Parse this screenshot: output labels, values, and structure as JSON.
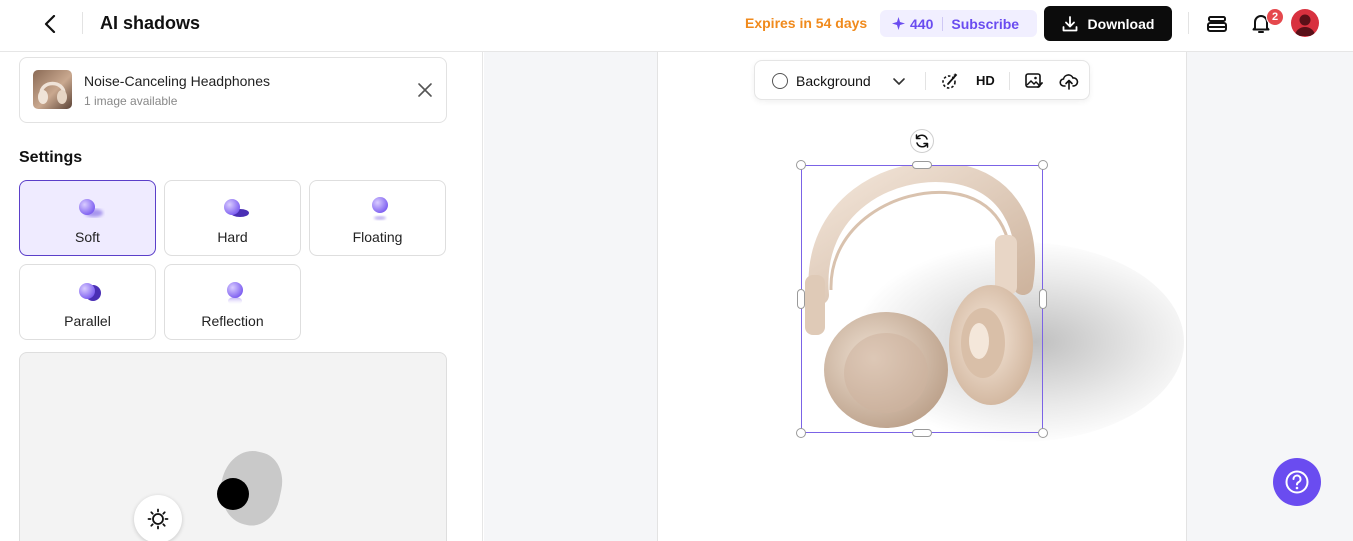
{
  "header": {
    "title": "AI shadows",
    "expires": "Expires in 54 days",
    "credits": "440",
    "subscribe_label": "Subscribe",
    "download_label": "Download",
    "notification_count": "2"
  },
  "product": {
    "name": "Noise-Canceling Headphones",
    "subtitle": "1 image available"
  },
  "settings": {
    "title": "Settings",
    "options": [
      {
        "label": "Soft",
        "selected": true
      },
      {
        "label": "Hard",
        "selected": false
      },
      {
        "label": "Floating",
        "selected": false
      },
      {
        "label": "Parallel",
        "selected": false
      },
      {
        "label": "Reflection",
        "selected": false
      }
    ]
  },
  "toolbar": {
    "background_label": "Background",
    "hd_label": "HD"
  },
  "icons": {
    "back": "chevron-left-icon",
    "credits": "sparkle-icon",
    "download": "download-icon",
    "layers": "layers-icon",
    "bell": "bell-icon",
    "close": "close-icon",
    "light": "sun-icon",
    "rotate": "rotate-icon",
    "help": "help-icon"
  },
  "colors": {
    "accent": "#6a4cf0",
    "expires": "#f08a1c",
    "selection": "#7b63e6",
    "badge": "#e5484d"
  }
}
